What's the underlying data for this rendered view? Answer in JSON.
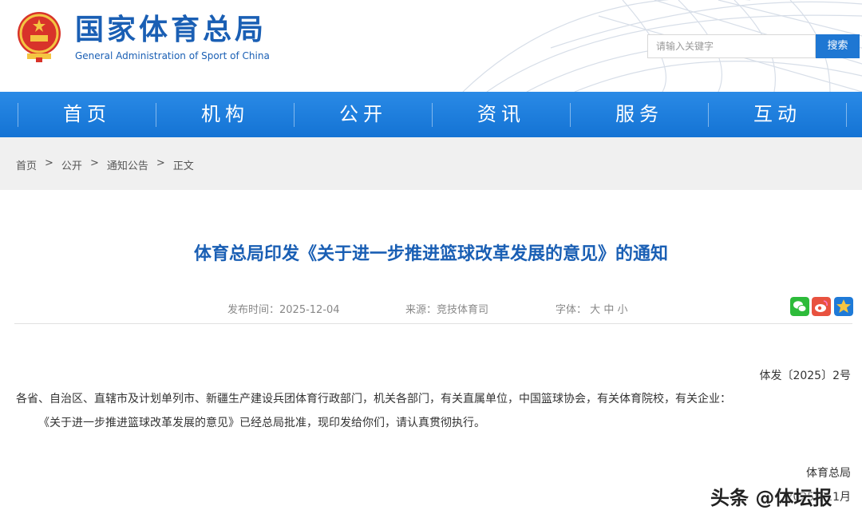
{
  "header": {
    "title_cn": "国家体育总局",
    "title_en": "General Administration of Sport of China",
    "search_placeholder": "请输入关键字",
    "search_button": "搜索"
  },
  "nav": {
    "items": [
      {
        "label": "首页"
      },
      {
        "label": "机构"
      },
      {
        "label": "公开"
      },
      {
        "label": "资讯"
      },
      {
        "label": "服务"
      },
      {
        "label": "互动"
      }
    ]
  },
  "breadcrumb": {
    "items": [
      "首页",
      "公开",
      "通知公告",
      "正文"
    ],
    "separator": ">"
  },
  "article": {
    "title": "体育总局印发《关于进一步推进篮球改革发展的意见》的通知",
    "publish_label": "发布时间：",
    "publish_date": "2025-12-04",
    "source_label": "来源：",
    "source": "竞技体育司",
    "font_label": "字体：",
    "font_large": "大",
    "font_medium": "中",
    "font_small": "小",
    "doc_number": "体发〔2025〕2号",
    "recipients": "各省、自治区、直辖市及计划单列市、新疆生产建设兵团体育行政部门，机关各部门，有关直属单位，中国篮球协会，有关体育院校，有关企业：",
    "body": "《关于进一步推进篮球改革发展的意见》已经总局批准，现印发给你们，请认真贯彻执行。",
    "signature": "体育总局",
    "sign_date": "2025年11月"
  },
  "share": {
    "icons": [
      "wechat-icon",
      "weibo-icon",
      "favorite-icon"
    ],
    "colors": [
      "#2dbb3a",
      "#e8523f",
      "#f0a81c"
    ]
  },
  "watermark": "头条 @体坛报",
  "colors": {
    "brand_blue": "#1a5fb4",
    "nav_blue": "#1e7ad8",
    "crumb_bg": "#f0f0f0"
  }
}
